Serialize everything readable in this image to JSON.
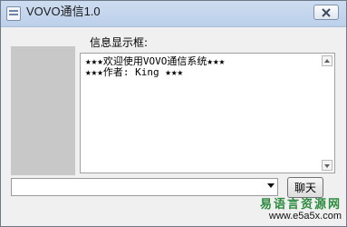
{
  "window": {
    "title": "VOVO通信1.0"
  },
  "info_panel": {
    "label": "信息显示框:"
  },
  "messages": [
    "★★★欢迎使用VOVO通信系统★★★",
    "★★★作者: King ★★★"
  ],
  "input": {
    "value": "",
    "placeholder": ""
  },
  "buttons": {
    "chat": "聊天"
  },
  "watermark": {
    "site_name": "易语言资源网",
    "url": "www.e5a5x.com"
  },
  "icons": {
    "app": "app-icon",
    "close": "close-icon",
    "dropdown": "chevron-down-icon"
  }
}
